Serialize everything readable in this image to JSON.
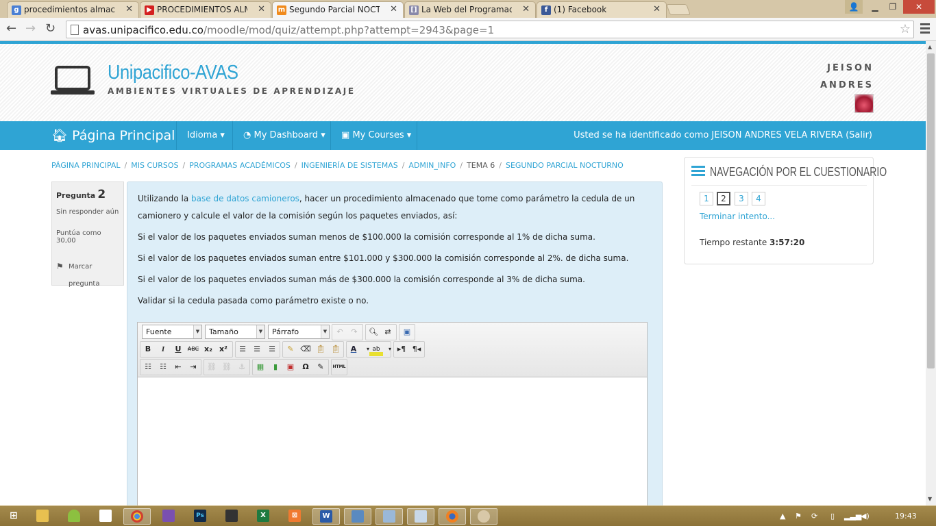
{
  "browser": {
    "tabs": [
      {
        "label": "procedimientos almacena",
        "icon": "google-icon",
        "color": "#4a7fd4"
      },
      {
        "label": "PROCEDIMIENTOS ALMAC",
        "icon": "youtube-icon",
        "color": "#d42020"
      },
      {
        "label": "Segundo Parcial NOCTUR",
        "icon": "moodle-icon",
        "color": "#f08a1c"
      },
      {
        "label": "La Web del Programador",
        "icon": "page-icon",
        "color": "#8888aa"
      },
      {
        "label": "(1) Facebook",
        "icon": "facebook-icon",
        "color": "#3b5998"
      }
    ],
    "url_host": "avas.unipacifico.edu.co",
    "url_path": "/moodle/mod/quiz/attempt.php?attempt=2943&page=1"
  },
  "header": {
    "site_name": "Unipacifico-AVAS",
    "site_subtitle": "AMBIENTES VIRTUALES DE APRENDIZAJE",
    "user_first": "JEISON",
    "user_last": "ANDRES"
  },
  "navbar": {
    "brand": "Página Principal",
    "menus": [
      "Idioma",
      "My Dashboard",
      "My Courses"
    ],
    "login_info": "Usted se ha identificado como JEISON ANDRES VELA RIVERA (Salir)"
  },
  "breadcrumb": [
    "PÁGINA PRINCIPAL",
    "MIS CURSOS",
    "PROGRAMAS ACADÉMICOS",
    "INGENIERÍA DE SISTEMAS",
    "ADMIN_INFO",
    "TEMA 6",
    "SEGUNDO PARCIAL NOCTURNO"
  ],
  "question_info": {
    "label": "Pregunta",
    "number": "2",
    "status": "Sin responder aún",
    "grade": "Puntúa como 30,00",
    "flag": "Marcar pregunta"
  },
  "question": {
    "intro_before": "Utilizando la ",
    "intro_link": "base de datos camioneros",
    "intro_after": ", hacer un procedimiento almacenado  que tome como parámetro la cedula de un camionero y calcule el valor de la comisión según los paquetes enviados, así:",
    "rule1": "Si el valor de los paquetes enviados suman menos de $100.000 la comisión corresponde al 1% de dicha suma.",
    "rule2": "Si el valor de los paquetes enviados suman entre $101.000 y $300.000 la comisión corresponde al 2%. de dicha suma.",
    "rule3": "Si el valor de los paquetes enviados suman más de $300.000 la comisión corresponde al 3% de dicha suma.",
    "validate": "Validar si la cedula pasada como parámetro existe o no."
  },
  "editor": {
    "font": "Fuente",
    "size": "Tamaño",
    "format": "Párrafo"
  },
  "quiz_nav": {
    "title": "NAVEGACIÓN POR EL CUESTIONARIO",
    "pages": [
      "1",
      "2",
      "3",
      "4"
    ],
    "current": "2",
    "finish": "Terminar intento...",
    "time_label": "Tiempo restante",
    "time_value": "3:57:20"
  },
  "taskbar": {
    "clock": "19:43"
  }
}
